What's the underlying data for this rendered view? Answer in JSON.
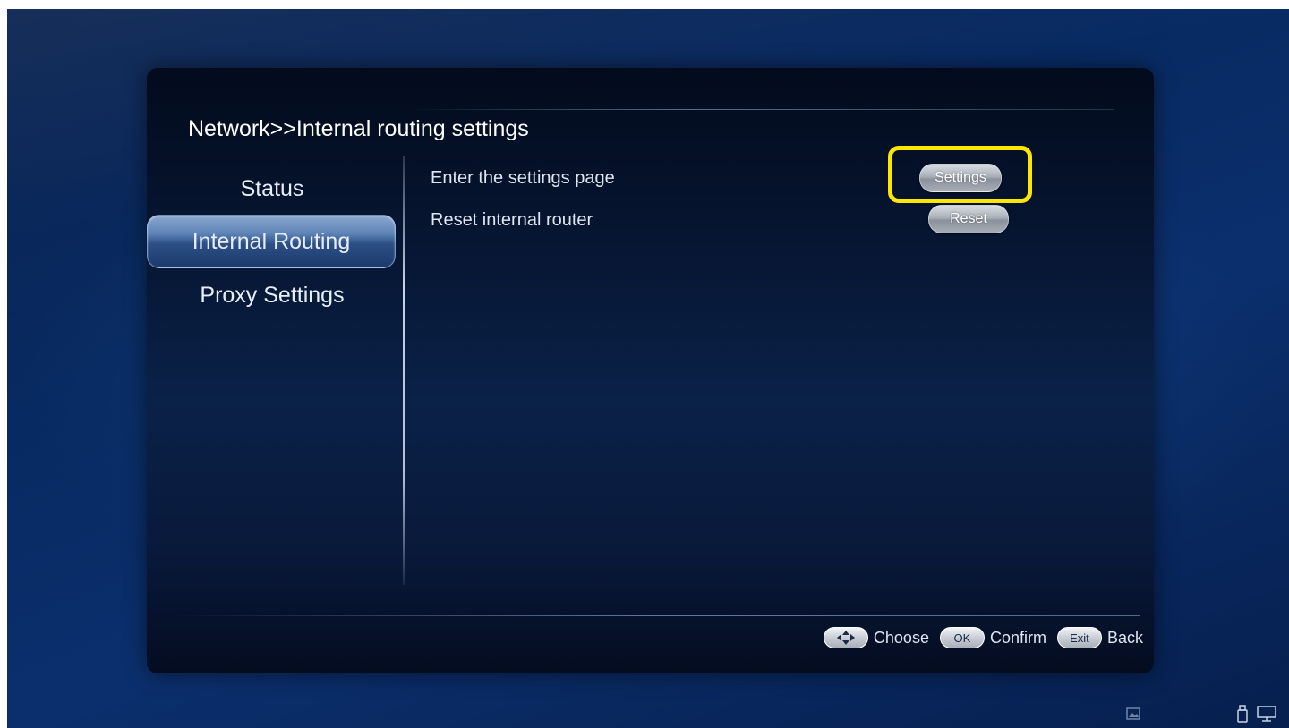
{
  "header": {
    "title": "Network>>Internal routing settings"
  },
  "sidebar": {
    "items": [
      {
        "label": "Status",
        "selected": false
      },
      {
        "label": "Internal Routing",
        "selected": true
      },
      {
        "label": "Proxy Settings",
        "selected": false
      }
    ]
  },
  "main": {
    "rows": [
      {
        "label": "Enter the settings page",
        "button": "Settings"
      },
      {
        "label": "Reset internal router",
        "button": "Reset"
      }
    ]
  },
  "footer": {
    "hints": [
      {
        "key_icon": "dpad-icon",
        "key": "",
        "text": "Choose"
      },
      {
        "key_icon": "",
        "key": "OK",
        "text": "Confirm"
      },
      {
        "key_icon": "",
        "key": "Exit",
        "text": "Back"
      }
    ]
  },
  "status_bar": {
    "icons": [
      "image-icon",
      "usb-drive-icon",
      "monitor-icon"
    ]
  },
  "colors": {
    "highlight": "#ffe600",
    "background": "#0b2f6d",
    "panel": "#06142f"
  }
}
